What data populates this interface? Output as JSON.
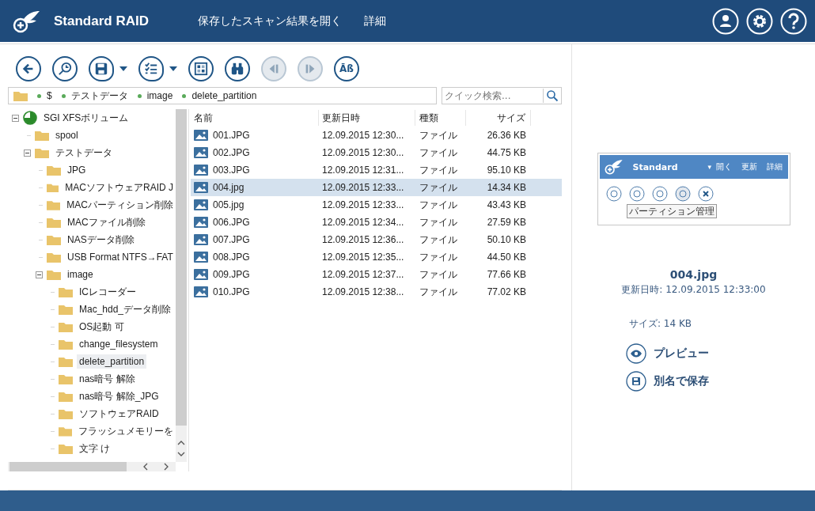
{
  "header": {
    "title": "Standard RAID",
    "menu": [
      "保存したスキャン結果を開く",
      "詳細"
    ]
  },
  "toolbar": [
    {
      "kind": "back",
      "disabled": false,
      "dropdown": false
    },
    {
      "kind": "scan",
      "disabled": false,
      "dropdown": false
    },
    {
      "kind": "save",
      "disabled": false,
      "dropdown": true
    },
    {
      "kind": "checklist",
      "disabled": false,
      "dropdown": true
    },
    {
      "kind": "grid",
      "disabled": false,
      "dropdown": false
    },
    {
      "kind": "binoculars",
      "disabled": false,
      "dropdown": false
    },
    {
      "kind": "prev",
      "disabled": true,
      "dropdown": false
    },
    {
      "kind": "next",
      "disabled": true,
      "dropdown": false
    },
    {
      "kind": "text",
      "label": "Āß",
      "disabled": false,
      "dropdown": false
    }
  ],
  "path": [
    "$",
    "テストデータ",
    "image",
    "delete_partition"
  ],
  "search": {
    "placeholder": "クイック検索..."
  },
  "tree": [
    {
      "label": "SGI XFSボリューム",
      "kind": "volume",
      "expanded": true,
      "selected": false,
      "children": [
        {
          "label": "spool",
          "selected": false
        },
        {
          "label": "テストデータ",
          "expanded": true,
          "selected": false,
          "children": [
            {
              "label": "JPG",
              "selected": false
            },
            {
              "label": "MACソフトウェアRAID J",
              "selected": false
            },
            {
              "label": "MACパーティション削除",
              "selected": false
            },
            {
              "label": "MACファイル削除",
              "selected": false
            },
            {
              "label": "NASデータ削除",
              "selected": false
            },
            {
              "label": "USB Format NTFS→FAT",
              "selected": false
            },
            {
              "label": "image",
              "expanded": true,
              "selected": false,
              "children": [
                {
                  "label": "ICレコーダー",
                  "selected": false
                },
                {
                  "label": "Mac_hdd_データ削除",
                  "selected": false
                },
                {
                  "label": "OS起動 可",
                  "selected": false
                },
                {
                  "label": "change_filesystem",
                  "selected": false
                },
                {
                  "label": "delete_partition",
                  "selected": true
                },
                {
                  "label": "nas暗号 解除",
                  "selected": false
                },
                {
                  "label": "nas暗号 解除_JPG",
                  "selected": false
                },
                {
                  "label": "ソフトウェアRAID",
                  "selected": false
                },
                {
                  "label": "フラッシュメモリーを",
                  "selected": false
                },
                {
                  "label": "文字 け",
                  "selected": false
                }
              ]
            }
          ]
        }
      ]
    }
  ],
  "table": {
    "columns": [
      "名前",
      "更新日時",
      "種類",
      "サイズ"
    ],
    "rows": [
      {
        "name": "001.JPG",
        "date": "12.09.2015 12:30...",
        "type": "ファイル",
        "size": "26.36 KB",
        "selected": false
      },
      {
        "name": "002.JPG",
        "date": "12.09.2015 12:30...",
        "type": "ファイル",
        "size": "44.75 KB",
        "selected": false
      },
      {
        "name": "003.JPG",
        "date": "12.09.2015 12:31...",
        "type": "ファイル",
        "size": "95.10 KB",
        "selected": false
      },
      {
        "name": "004.jpg",
        "date": "12.09.2015 12:33...",
        "type": "ファイル",
        "size": "14.34 KB",
        "selected": true
      },
      {
        "name": "005.jpg",
        "date": "12.09.2015 12:33...",
        "type": "ファイル",
        "size": "43.43 KB",
        "selected": false
      },
      {
        "name": "006.JPG",
        "date": "12.09.2015 12:34...",
        "type": "ファイル",
        "size": "27.59 KB",
        "selected": false
      },
      {
        "name": "007.JPG",
        "date": "12.09.2015 12:36...",
        "type": "ファイル",
        "size": "50.10 KB",
        "selected": false
      },
      {
        "name": "008.JPG",
        "date": "12.09.2015 12:35...",
        "type": "ファイル",
        "size": "44.50 KB",
        "selected": false
      },
      {
        "name": "009.JPG",
        "date": "12.09.2015 12:37...",
        "type": "ファイル",
        "size": "77.66 KB",
        "selected": false
      },
      {
        "name": "010.JPG",
        "date": "12.09.2015 12:38...",
        "type": "ファイル",
        "size": "77.02 KB",
        "selected": false
      }
    ]
  },
  "preview": {
    "thumbnail": {
      "title": "Standard",
      "caret": "▾",
      "menu": [
        "開く",
        "更新",
        "詳細"
      ],
      "tooltip": "パーティション管理"
    },
    "file_name": "004.jpg",
    "modified": "更新日時: 12.09.2015 12:33:00",
    "size": "サイズ: 14 KB",
    "actions": [
      {
        "kind": "preview",
        "label": "プレビュー"
      },
      {
        "kind": "save",
        "label": "別名で保存"
      }
    ]
  }
}
